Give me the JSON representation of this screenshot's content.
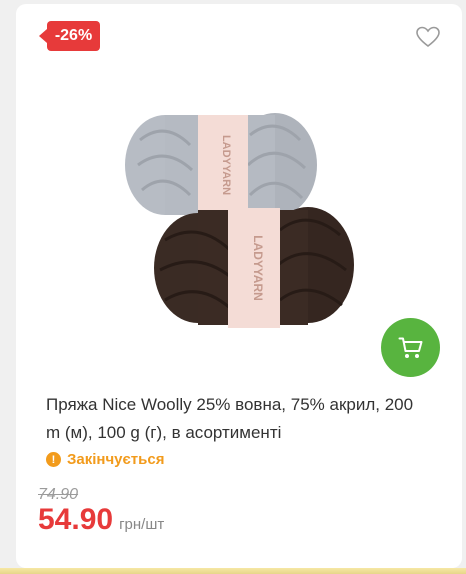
{
  "badge": {
    "discount": "-26%"
  },
  "product": {
    "title": "Пряжа Nice Woolly 25% вовна, 75% акрил, 200 m (м), 100 g (г), в асортименті",
    "status": "Закінчується",
    "old_price": "74.90",
    "price": "54.90",
    "unit": "грн/шт",
    "image_label_top": "LADYYARN",
    "image_label_bottom": "LADYYARN"
  },
  "icons": {
    "wishlist": "heart-icon",
    "cart": "cart-icon",
    "status": "warning-icon"
  },
  "colors": {
    "accent_red": "#e73a3a",
    "accent_green": "#58b43f",
    "status_orange": "#f29b1c"
  }
}
